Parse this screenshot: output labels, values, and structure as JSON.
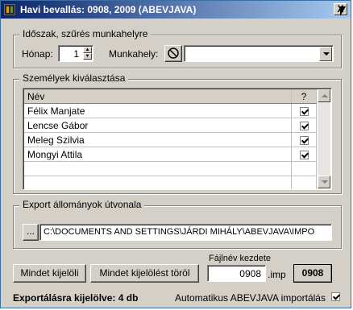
{
  "window": {
    "title": "Havi bevallás: 0908, 2009 (ABEVJAVA)",
    "close_label": "X"
  },
  "period_group": {
    "title": "Időszak, szűrés munkahelyre",
    "month_label": "Hónap:",
    "month_value": "1",
    "workplace_label": "Munkahely:",
    "workplace_value": ""
  },
  "persons_group": {
    "title": "Személyek kiválasztása",
    "columns": [
      "Név",
      "?"
    ],
    "rows": [
      {
        "name": "Félix Manjate",
        "checked": true
      },
      {
        "name": "Lencse Gábor",
        "checked": true
      },
      {
        "name": "Meleg Szilvia",
        "checked": true
      },
      {
        "name": "Mongyi Attila",
        "checked": true
      }
    ]
  },
  "export_group": {
    "title": "Export állományok útvonala",
    "browse_label": "...",
    "path_value": "C:\\DOCUMENTS AND SETTINGS\\JÁRDI MIHÁLY\\ABEVJAVA\\IMPO"
  },
  "buttons": {
    "select_all": "Mindet kijelöli",
    "clear_all": "Mindet kijelölést töröl",
    "action": "0908"
  },
  "filename": {
    "label": "Fájlnév kezdete",
    "value": "0908",
    "suffix": ".imp"
  },
  "status": {
    "selected_text": "Exportálásra kijelölve: 4 db",
    "auto_import_label": "Automatikus ABEVJAVA importálás",
    "auto_import_checked": true
  }
}
